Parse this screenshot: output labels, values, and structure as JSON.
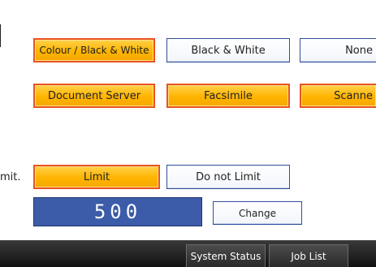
{
  "row1": {
    "colour_bw": "Colour / Black & White",
    "bw": "Black & White",
    "none": "None"
  },
  "row2": {
    "document_server": "Document Server",
    "facsimile": "Facsimile",
    "scanner": "Scanne"
  },
  "limit_row": {
    "label": "mit.",
    "limit": "Limit",
    "do_not_limit": "Do not Limit"
  },
  "counter": {
    "value": "500",
    "change": "Change"
  },
  "bottom_bar": {
    "system_status": "System Status",
    "job_list": "Job List"
  },
  "colors": {
    "selected_fill": "#ffb400",
    "selected_border": "#e8541f",
    "unselected_border": "#2f4f9c",
    "display_bg": "#3c5ba8",
    "bottom_bar": "#1e1e1e"
  }
}
